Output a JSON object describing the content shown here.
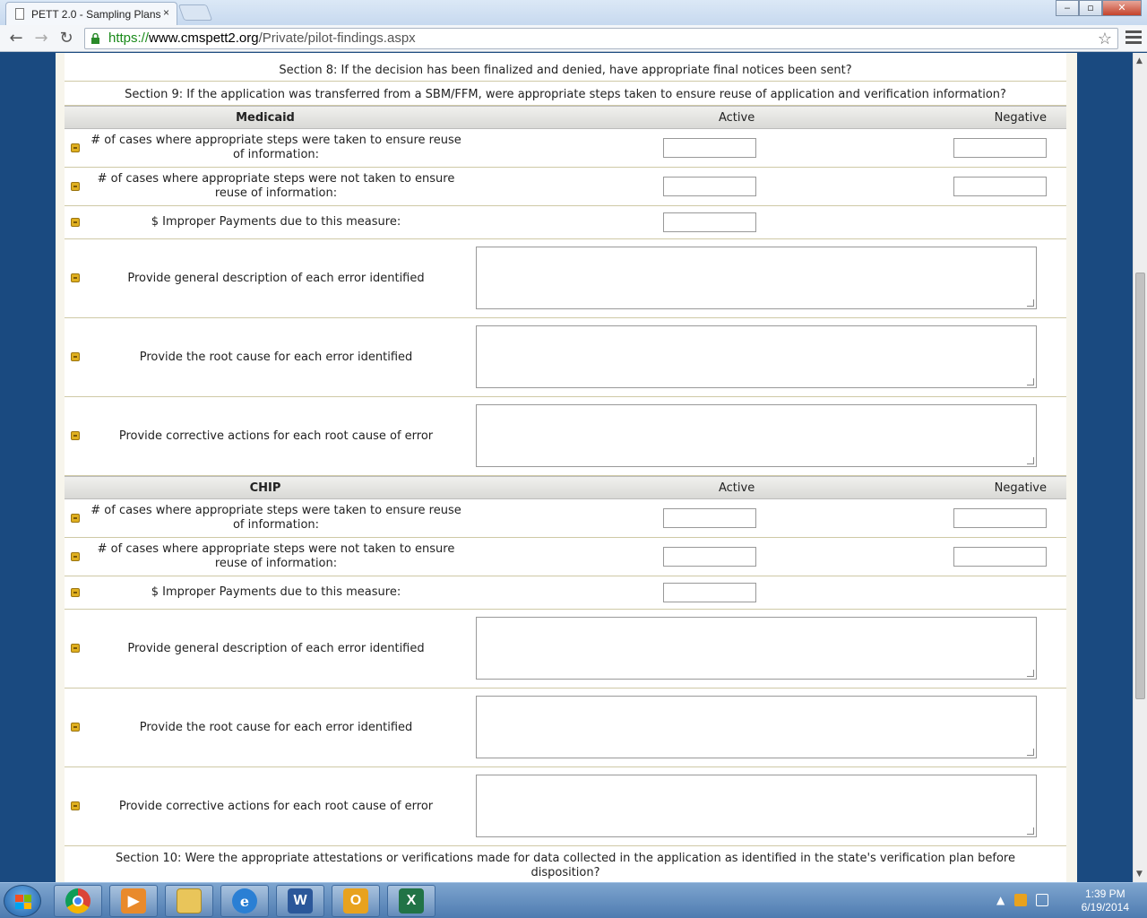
{
  "browser": {
    "tab_title": "PETT 2.0 - Sampling Plans",
    "tab_close": "×",
    "url_scheme": "https://",
    "url_host": "www.cmspett2.org",
    "url_path": "/Private/pilot-findings.aspx",
    "back": "←",
    "forward": "→",
    "reload": "↻",
    "star": "☆",
    "min": "‒",
    "max": "▫",
    "close": "✕"
  },
  "page": {
    "section8": "Section 8: If the decision has been finalized and denied, have appropriate final notices been sent?",
    "section9": "Section 9: If the application was transferred from a SBM/FFM, were appropriate steps taken to ensure reuse of application and verification information?",
    "section10": "Section 10: Were the appropriate attestations or verifications made for data collected in the application as identified in the state's verification plan before disposition?",
    "medicaid": {
      "header": "Medicaid",
      "col_active": "Active",
      "col_negative": "Negative",
      "row_taken": "# of cases where appropriate steps were taken to ensure reuse of information:",
      "row_not_taken": "# of cases where appropriate steps were not taken to ensure reuse of information:",
      "row_payments": "$ Improper Payments due to this measure:",
      "row_description": "Provide general description of each error identified",
      "row_root_cause": "Provide the root cause for each error identified",
      "row_corrective": "Provide corrective actions for each root cause of error"
    },
    "chip": {
      "header": "CHIP",
      "col_active": "Active",
      "col_negative": "Negative",
      "row_taken": "# of cases where appropriate steps were taken to ensure reuse of information:",
      "row_not_taken": "# of cases where appropriate steps were not taken to ensure reuse of information:",
      "row_payments": "$ Improper Payments due to this measure:",
      "row_description": "Provide general description of each error identified",
      "row_root_cause": "Provide the root cause for each error identified",
      "row_corrective": "Provide corrective actions for each root cause of error"
    }
  },
  "taskbar": {
    "time": "1:39 PM",
    "date": "6/19/2014",
    "word": "W",
    "excel": "X",
    "outlook": "O"
  },
  "colors": {
    "page_border": "#1a4a80",
    "row_rule": "#cfc9a6",
    "bullet": "#e0b020"
  }
}
